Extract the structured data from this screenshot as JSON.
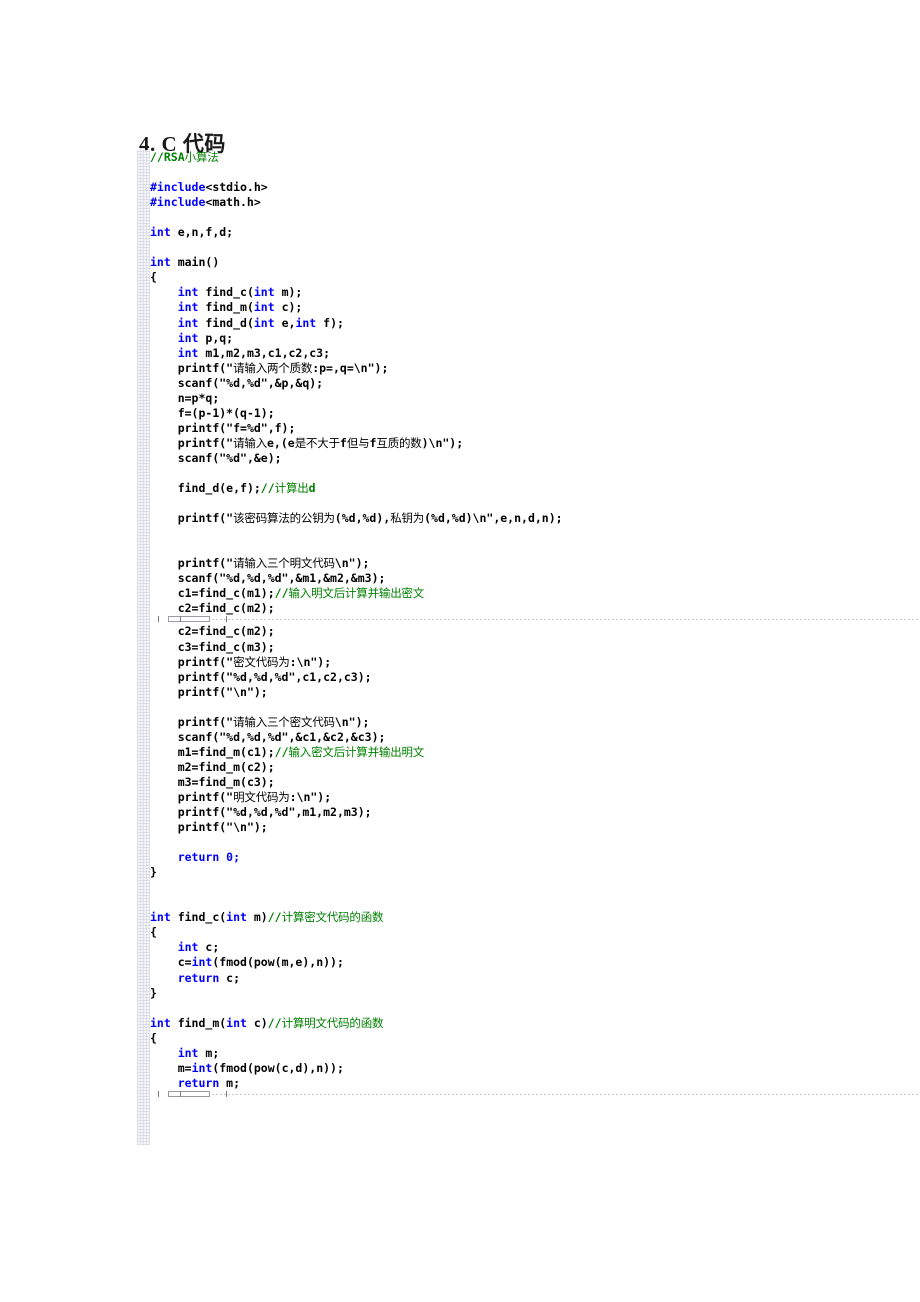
{
  "document": {
    "heading": "4. C 代码",
    "colors": {
      "keyword": "#0000FF",
      "comment": "#008000",
      "text": "#000000",
      "background": "#FFFFFF",
      "gutter": "#F3F4F7"
    }
  },
  "code": {
    "language": "C",
    "lines": [
      {
        "indent": 0,
        "tokens": [
          {
            "t": "//RSA",
            "c": "cmt"
          },
          {
            "t": "小算法",
            "c": "cmt cjk"
          }
        ]
      },
      {
        "indent": 0,
        "tokens": []
      },
      {
        "indent": 0,
        "tokens": [
          {
            "t": "#include",
            "c": "kw"
          },
          {
            "t": "<stdio.h>",
            "c": "plain"
          }
        ]
      },
      {
        "indent": 0,
        "tokens": [
          {
            "t": "#include",
            "c": "kw"
          },
          {
            "t": "<math.h>",
            "c": "plain"
          }
        ]
      },
      {
        "indent": 0,
        "tokens": []
      },
      {
        "indent": 0,
        "tokens": [
          {
            "t": "int",
            "c": "kw"
          },
          {
            "t": " e,n,f,d;",
            "c": "plain"
          }
        ]
      },
      {
        "indent": 0,
        "tokens": []
      },
      {
        "indent": 0,
        "tokens": [
          {
            "t": "int",
            "c": "kw"
          },
          {
            "t": " main()",
            "c": "plain"
          }
        ]
      },
      {
        "indent": 0,
        "tokens": [
          {
            "t": "{",
            "c": "plain"
          }
        ]
      },
      {
        "indent": 1,
        "tokens": [
          {
            "t": "int",
            "c": "kw"
          },
          {
            "t": " find_c(",
            "c": "plain"
          },
          {
            "t": "int",
            "c": "kw"
          },
          {
            "t": " m);",
            "c": "plain"
          }
        ]
      },
      {
        "indent": 1,
        "tokens": [
          {
            "t": "int",
            "c": "kw"
          },
          {
            "t": " find_m(",
            "c": "plain"
          },
          {
            "t": "int",
            "c": "kw"
          },
          {
            "t": " c);",
            "c": "plain"
          }
        ]
      },
      {
        "indent": 1,
        "tokens": [
          {
            "t": "int",
            "c": "kw"
          },
          {
            "t": " find_d(",
            "c": "plain"
          },
          {
            "t": "int",
            "c": "kw"
          },
          {
            "t": " e,",
            "c": "plain"
          },
          {
            "t": "int",
            "c": "kw"
          },
          {
            "t": " f);",
            "c": "plain"
          }
        ]
      },
      {
        "indent": 1,
        "tokens": [
          {
            "t": "int",
            "c": "kw"
          },
          {
            "t": " p,q;",
            "c": "plain"
          }
        ]
      },
      {
        "indent": 1,
        "tokens": [
          {
            "t": "int",
            "c": "kw"
          },
          {
            "t": " m1,m2,m3,c1,c2,c3;",
            "c": "plain"
          }
        ]
      },
      {
        "indent": 1,
        "tokens": [
          {
            "t": "printf(\"",
            "c": "plain"
          },
          {
            "t": "请输入两个质数",
            "c": "plain cjk"
          },
          {
            "t": ":p=,q=\\n\");",
            "c": "plain"
          }
        ]
      },
      {
        "indent": 1,
        "tokens": [
          {
            "t": "scanf(\"%d,%d\",&p,&q);",
            "c": "plain"
          }
        ]
      },
      {
        "indent": 1,
        "tokens": [
          {
            "t": "n=p*q;",
            "c": "plain"
          }
        ]
      },
      {
        "indent": 1,
        "tokens": [
          {
            "t": "f=(p-1)*(q-1);",
            "c": "plain"
          }
        ]
      },
      {
        "indent": 1,
        "tokens": [
          {
            "t": "printf(\"f=%d\",f);",
            "c": "plain"
          }
        ]
      },
      {
        "indent": 1,
        "tokens": [
          {
            "t": "printf(\"",
            "c": "plain"
          },
          {
            "t": "请输入",
            "c": "plain cjk"
          },
          {
            "t": "e,(e",
            "c": "plain"
          },
          {
            "t": "是不大于",
            "c": "plain cjk"
          },
          {
            "t": "f",
            "c": "plain"
          },
          {
            "t": "但与",
            "c": "plain cjk"
          },
          {
            "t": "f",
            "c": "plain"
          },
          {
            "t": "互质的数",
            "c": "plain cjk"
          },
          {
            "t": ")\\n\");",
            "c": "plain"
          }
        ]
      },
      {
        "indent": 1,
        "tokens": [
          {
            "t": "scanf(\"%d\",&e);",
            "c": "plain"
          }
        ]
      },
      {
        "indent": 1,
        "tokens": []
      },
      {
        "indent": 1,
        "tokens": [
          {
            "t": "find_d(e,f);",
            "c": "plain"
          },
          {
            "t": "//",
            "c": "cmt"
          },
          {
            "t": "计算出",
            "c": "cmt cjk"
          },
          {
            "t": "d",
            "c": "cmt"
          }
        ]
      },
      {
        "indent": 1,
        "tokens": []
      },
      {
        "indent": 1,
        "tokens": [
          {
            "t": "printf(\"",
            "c": "plain"
          },
          {
            "t": "该密码算法的公钥为",
            "c": "plain cjk"
          },
          {
            "t": "(%d,%d),",
            "c": "plain"
          },
          {
            "t": "私钥为",
            "c": "plain cjk"
          },
          {
            "t": "(%d,%d)\\n\",e,n,d,n);",
            "c": "plain"
          }
        ]
      },
      {
        "indent": 1,
        "tokens": []
      },
      {
        "indent": 1,
        "tokens": []
      },
      {
        "indent": 1,
        "tokens": [
          {
            "t": "printf(\"",
            "c": "plain"
          },
          {
            "t": "请输入三个明文代码",
            "c": "plain cjk"
          },
          {
            "t": "\\n\");",
            "c": "plain"
          }
        ]
      },
      {
        "indent": 1,
        "tokens": [
          {
            "t": "scanf(\"%d,%d,%d\",&m1,&m2,&m3);",
            "c": "plain"
          }
        ]
      },
      {
        "indent": 1,
        "tokens": [
          {
            "t": "c1=find_c(m1);",
            "c": "plain"
          },
          {
            "t": "//",
            "c": "cmt"
          },
          {
            "t": "输入明文后计算并输出密文",
            "c": "cmt cjk"
          }
        ]
      },
      {
        "indent": 1,
        "tokens": [
          {
            "t": "c2=find_c(m2);",
            "c": "plain"
          }
        ]
      },
      {
        "pagebreak": true
      },
      {
        "indent": 1,
        "tokens": [
          {
            "t": "c2=find_c(m2);",
            "c": "plain"
          }
        ]
      },
      {
        "indent": 1,
        "tokens": [
          {
            "t": "c3=find_c(m3);",
            "c": "plain"
          }
        ]
      },
      {
        "indent": 1,
        "tokens": [
          {
            "t": "printf(\"",
            "c": "plain"
          },
          {
            "t": "密文代码为",
            "c": "plain cjk"
          },
          {
            "t": ":\\n\");",
            "c": "plain"
          }
        ]
      },
      {
        "indent": 1,
        "tokens": [
          {
            "t": "printf(\"%d,%d,%d\",c1,c2,c3);",
            "c": "plain"
          }
        ]
      },
      {
        "indent": 1,
        "tokens": [
          {
            "t": "printf(\"\\n\");",
            "c": "plain"
          }
        ]
      },
      {
        "indent": 1,
        "tokens": []
      },
      {
        "indent": 1,
        "tokens": [
          {
            "t": "printf(\"",
            "c": "plain"
          },
          {
            "t": "请输入三个密文代码",
            "c": "plain cjk"
          },
          {
            "t": "\\n\");",
            "c": "plain"
          }
        ]
      },
      {
        "indent": 1,
        "tokens": [
          {
            "t": "scanf(\"%d,%d,%d\",&c1,&c2,&c3);",
            "c": "plain"
          }
        ]
      },
      {
        "indent": 1,
        "tokens": [
          {
            "t": "m1=find_m(c1);",
            "c": "plain"
          },
          {
            "t": "//",
            "c": "cmt"
          },
          {
            "t": "输入密文后计算并输出明文",
            "c": "cmt cjk"
          }
        ]
      },
      {
        "indent": 1,
        "tokens": [
          {
            "t": "m2=find_m(c2);",
            "c": "plain"
          }
        ]
      },
      {
        "indent": 1,
        "tokens": [
          {
            "t": "m3=find_m(c3);",
            "c": "plain"
          }
        ]
      },
      {
        "indent": 1,
        "tokens": [
          {
            "t": "printf(\"",
            "c": "plain"
          },
          {
            "t": "明文代码为",
            "c": "plain cjk"
          },
          {
            "t": ":\\n\");",
            "c": "plain"
          }
        ]
      },
      {
        "indent": 1,
        "tokens": [
          {
            "t": "printf(\"%d,%d,%d\",m1,m2,m3);",
            "c": "plain"
          }
        ]
      },
      {
        "indent": 1,
        "tokens": [
          {
            "t": "printf(\"\\n\");",
            "c": "plain"
          }
        ]
      },
      {
        "indent": 1,
        "tokens": []
      },
      {
        "indent": 1,
        "tokens": [
          {
            "t": "return",
            "c": "kw"
          },
          {
            "t": " 0;",
            "c": "kw"
          }
        ]
      },
      {
        "indent": 0,
        "tokens": [
          {
            "t": "}",
            "c": "plain"
          }
        ]
      },
      {
        "indent": 0,
        "tokens": []
      },
      {
        "indent": 0,
        "tokens": []
      },
      {
        "indent": 0,
        "tokens": [
          {
            "t": "int",
            "c": "kw"
          },
          {
            "t": " find_c(",
            "c": "plain"
          },
          {
            "t": "int",
            "c": "kw"
          },
          {
            "t": " m)",
            "c": "plain"
          },
          {
            "t": "//",
            "c": "cmt"
          },
          {
            "t": "计算密文代码的函数",
            "c": "cmt cjk"
          }
        ]
      },
      {
        "indent": 0,
        "tokens": [
          {
            "t": "{",
            "c": "plain"
          }
        ]
      },
      {
        "indent": 1,
        "tokens": [
          {
            "t": "int",
            "c": "kw"
          },
          {
            "t": " c;",
            "c": "plain"
          }
        ]
      },
      {
        "indent": 1,
        "tokens": [
          {
            "t": "c=",
            "c": "plain"
          },
          {
            "t": "int",
            "c": "kw"
          },
          {
            "t": "(fmod(pow(m,e),n));",
            "c": "plain"
          }
        ]
      },
      {
        "indent": 1,
        "tokens": [
          {
            "t": "return",
            "c": "kw"
          },
          {
            "t": " c;",
            "c": "plain"
          }
        ]
      },
      {
        "indent": 0,
        "tokens": [
          {
            "t": "}",
            "c": "plain"
          }
        ]
      },
      {
        "indent": 0,
        "tokens": []
      },
      {
        "indent": 0,
        "tokens": [
          {
            "t": "int",
            "c": "kw"
          },
          {
            "t": " find_m(",
            "c": "plain"
          },
          {
            "t": "int",
            "c": "kw"
          },
          {
            "t": " c)",
            "c": "plain"
          },
          {
            "t": "//",
            "c": "cmt"
          },
          {
            "t": "计算明文代码的函数",
            "c": "cmt cjk"
          }
        ]
      },
      {
        "indent": 0,
        "tokens": [
          {
            "t": "{",
            "c": "plain"
          }
        ]
      },
      {
        "indent": 1,
        "tokens": [
          {
            "t": "int",
            "c": "kw"
          },
          {
            "t": " m;",
            "c": "plain"
          }
        ]
      },
      {
        "indent": 1,
        "tokens": [
          {
            "t": "m=",
            "c": "plain"
          },
          {
            "t": "int",
            "c": "kw"
          },
          {
            "t": "(fmod(pow(c,d),n));",
            "c": "plain"
          }
        ]
      },
      {
        "indent": 1,
        "tokens": [
          {
            "t": "return",
            "c": "kw"
          },
          {
            "t": " m;",
            "c": "plain"
          }
        ]
      },
      {
        "pagebreak": true
      }
    ]
  }
}
